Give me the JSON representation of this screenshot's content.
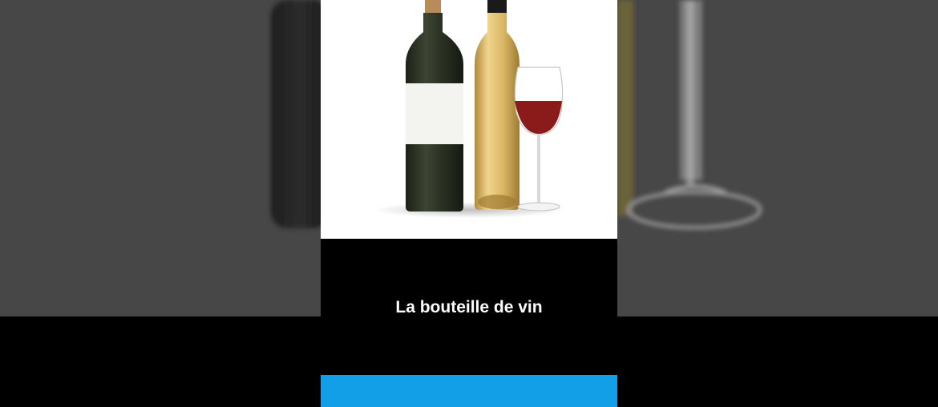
{
  "caption": {
    "text": "La bouteille de vin"
  },
  "icons": {
    "photo": "wine-bottles-and-glass-illustration",
    "background": "blurred-wine-bottles-background"
  },
  "colors": {
    "side_background": "#474747",
    "panel_background": "#000000",
    "photo_background": "#ffffff",
    "caption_text": "#ffffff",
    "bottom_bar": "#139ee8",
    "red_bottle": "#2a2f22",
    "white_wine": "#d9b86a",
    "red_wine": "#8b1a1a"
  }
}
